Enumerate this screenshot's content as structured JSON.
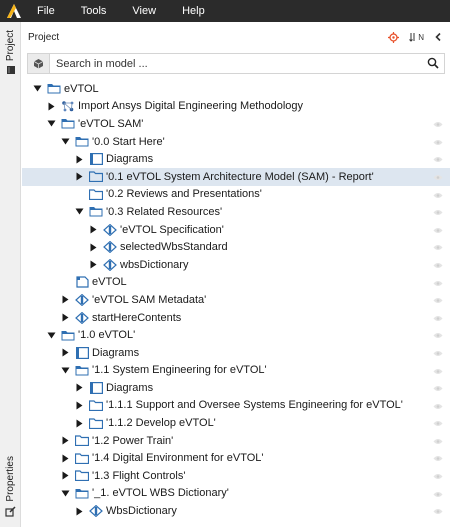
{
  "menu": {
    "items": [
      {
        "label": "File"
      },
      {
        "label": "Tools"
      },
      {
        "label": "View"
      },
      {
        "label": "Help"
      }
    ]
  },
  "side": {
    "project_label": "Project",
    "properties_label": "Properties"
  },
  "panel": {
    "title": "Project",
    "sort_label": "N"
  },
  "search": {
    "placeholder": "Search in model ..."
  },
  "tree": [
    {
      "label": "eVTOL",
      "depth": 0,
      "twisty": "open",
      "icon": "package-open-icon",
      "eye": false
    },
    {
      "label": "Import Ansys Digital Engineering Methodology",
      "depth": 1,
      "twisty": "closed",
      "icon": "network-icon",
      "eye": false
    },
    {
      "label": "'eVTOL SAM'",
      "depth": 1,
      "twisty": "open",
      "icon": "package-open-icon",
      "eye": true
    },
    {
      "label": "'0.0 Start Here'",
      "depth": 2,
      "twisty": "open",
      "icon": "package-open-icon",
      "eye": true
    },
    {
      "label": "Diagrams",
      "depth": 3,
      "twisty": "closed",
      "icon": "diagram-icon",
      "eye": true
    },
    {
      "label": "'0.1 eVTOL System Architecture Model (SAM) - Report'",
      "depth": 3,
      "twisty": "closed",
      "icon": "package-icon",
      "eye": true,
      "selected": true
    },
    {
      "label": "'0.2 Reviews and Presentations'",
      "depth": 3,
      "twisty": "none",
      "icon": "package-icon",
      "eye": true
    },
    {
      "label": "'0.3 Related Resources'",
      "depth": 3,
      "twisty": "open",
      "icon": "package-open-icon",
      "eye": true
    },
    {
      "label": "'eVTOL Specification'",
      "depth": 4,
      "twisty": "closed",
      "icon": "element-icon",
      "eye": true
    },
    {
      "label": "selectedWbsStandard",
      "depth": 4,
      "twisty": "closed",
      "icon": "element-icon",
      "eye": true
    },
    {
      "label": "wbsDictionary",
      "depth": 4,
      "twisty": "closed",
      "icon": "element-icon",
      "eye": true
    },
    {
      "label": "eVTOL",
      "depth": 2,
      "twisty": "none",
      "icon": "document-icon",
      "eye": true
    },
    {
      "label": "'eVTOL SAM Metadata'",
      "depth": 2,
      "twisty": "closed",
      "icon": "element-icon",
      "eye": true
    },
    {
      "label": "startHereContents",
      "depth": 2,
      "twisty": "closed",
      "icon": "element-icon",
      "eye": true
    },
    {
      "label": "'1.0 eVTOL'",
      "depth": 1,
      "twisty": "open",
      "icon": "package-open-icon",
      "eye": true
    },
    {
      "label": "Diagrams",
      "depth": 2,
      "twisty": "closed",
      "icon": "diagram-icon",
      "eye": true
    },
    {
      "label": "'1.1 System Engineering for eVTOL'",
      "depth": 2,
      "twisty": "open",
      "icon": "package-open-icon",
      "eye": true
    },
    {
      "label": "Diagrams",
      "depth": 3,
      "twisty": "closed",
      "icon": "diagram-icon",
      "eye": true
    },
    {
      "label": "'1.1.1 Support and Oversee Systems Engineering for eVTOL'",
      "depth": 3,
      "twisty": "closed",
      "icon": "package-icon",
      "eye": true
    },
    {
      "label": "'1.1.2 Develop eVTOL'",
      "depth": 3,
      "twisty": "closed",
      "icon": "package-icon",
      "eye": true
    },
    {
      "label": "'1.2 Power Train'",
      "depth": 2,
      "twisty": "closed",
      "icon": "package-icon",
      "eye": true
    },
    {
      "label": "'1.4 Digital Environment for eVTOL'",
      "depth": 2,
      "twisty": "closed",
      "icon": "package-icon",
      "eye": true
    },
    {
      "label": "'1.3 Flight Controls'",
      "depth": 2,
      "twisty": "closed",
      "icon": "package-icon",
      "eye": true
    },
    {
      "label": "'_1. eVTOL WBS Dictionary'",
      "depth": 2,
      "twisty": "open",
      "icon": "package-open-icon",
      "eye": true
    },
    {
      "label": "WbsDictionary",
      "depth": 3,
      "twisty": "closed",
      "icon": "element-icon",
      "eye": true
    }
  ],
  "colors": {
    "menubar": "#2b2b2b",
    "accent_logo": "#f6b418",
    "target_icon": "#e8502a",
    "folder_blue": "#2f6fb2",
    "selection": "#dde6f0"
  }
}
